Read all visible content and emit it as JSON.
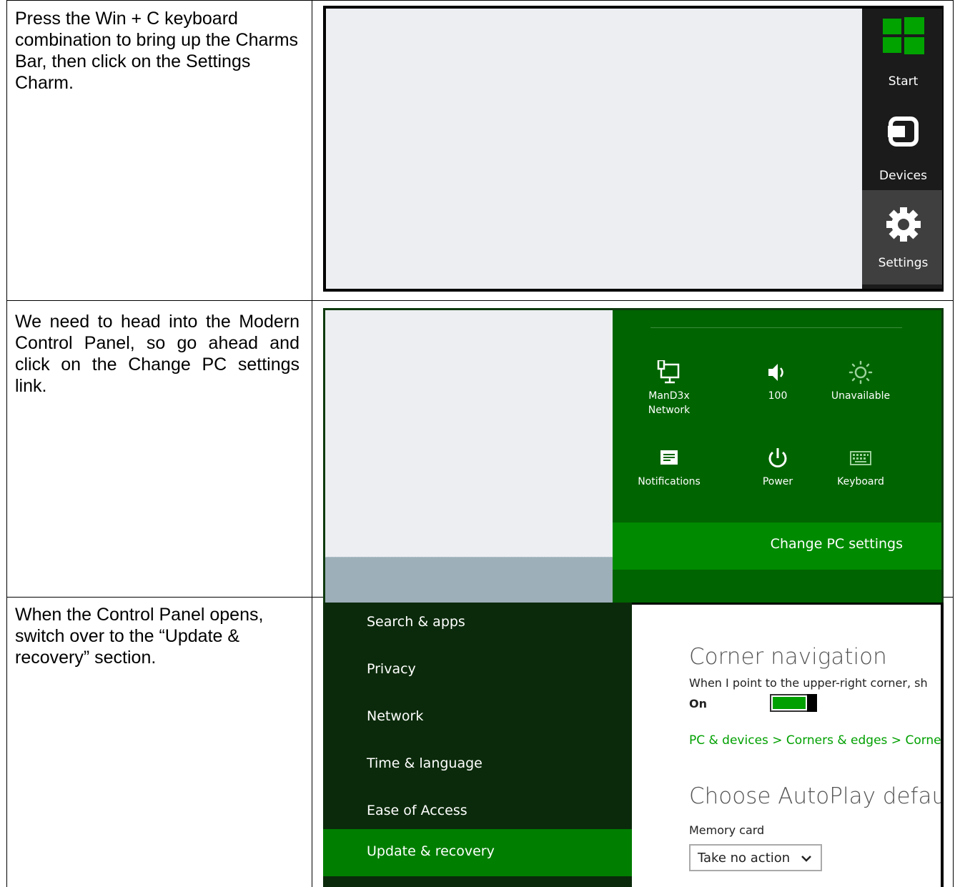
{
  "steps": [
    {
      "text": "Press the Win + C keyboard combination to bring up the Charms Bar, then click on the Settings Charm."
    },
    {
      "text": "We need to head into the Modern Control Panel, so go ahead and click on the Change PC settings link."
    },
    {
      "text": "When the Control Panel opens, switch over to the “Update & recovery” section."
    }
  ],
  "charms_bar": {
    "items": [
      {
        "label": "Start",
        "icon": "windows-logo-icon"
      },
      {
        "label": "Devices",
        "icon": "devices-icon"
      },
      {
        "label": "Settings",
        "icon": "gear-icon",
        "selected": true
      }
    ],
    "colors": {
      "background": "#1b1b1b",
      "selected": "#3f3f3f",
      "logo": "#00a300"
    }
  },
  "settings_pane": {
    "tiles": [
      {
        "label": "ManD3x\nNetwork",
        "icon": "network-icon"
      },
      {
        "label": "100",
        "icon": "volume-icon"
      },
      {
        "label": "Unavailable",
        "icon": "brightness-icon"
      },
      {
        "label": "Notifications",
        "icon": "notifications-icon"
      },
      {
        "label": "Power",
        "icon": "power-icon"
      },
      {
        "label": "Keyboard",
        "icon": "keyboard-icon"
      }
    ],
    "change_pc_settings": "Change PC settings",
    "colors": {
      "background": "#006400",
      "highlight": "#008a00"
    }
  },
  "pc_settings": {
    "nav": [
      {
        "label": "Search & apps"
      },
      {
        "label": "Privacy"
      },
      {
        "label": "Network"
      },
      {
        "label": "Time & language"
      },
      {
        "label": "Ease of Access"
      },
      {
        "label": "Update & recovery",
        "selected": true
      }
    ],
    "corner_nav": {
      "heading": "Corner navigation",
      "description": "When I point to the upper-right corner, sh",
      "toggle_state": "On",
      "toggle_on": true,
      "path": "PC & devices > Corners & edges > Corne"
    },
    "autoplay": {
      "heading": "Choose AutoPlay defaul",
      "memory_card_label": "Memory card",
      "memory_card_value": "Take no action"
    },
    "colors": {
      "nav_background": "#0b2a0b",
      "nav_selected": "#007e00",
      "link": "#00a000"
    }
  }
}
